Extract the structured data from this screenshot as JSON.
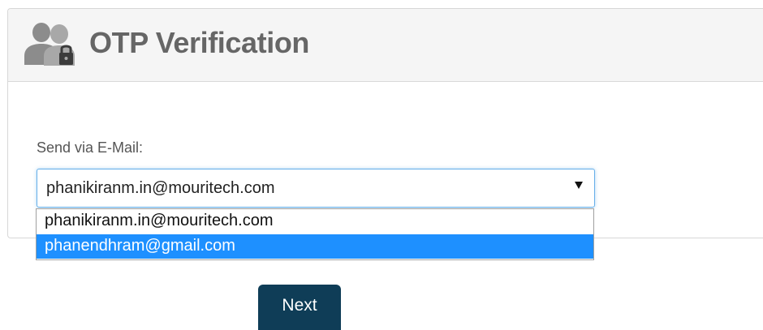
{
  "panel": {
    "title": "OTP Verification",
    "icon": "users-lock-icon"
  },
  "form": {
    "label": "Send via E-Mail:",
    "selected_value": "phanikiranm.in@mouritech.com",
    "arrow_icon": "dropdown-arrow-icon",
    "options": [
      {
        "label": "phanikiranm.in@mouritech.com",
        "highlighted": false
      },
      {
        "label": "phanendhram@gmail.com",
        "highlighted": true
      }
    ]
  },
  "actions": {
    "next_label": "Next"
  },
  "colors": {
    "header_background": "#f5f5f5",
    "title_text": "#666666",
    "focus_border": "#66afe9",
    "highlight": "#1e90ff",
    "button_background": "#0f3d57"
  }
}
